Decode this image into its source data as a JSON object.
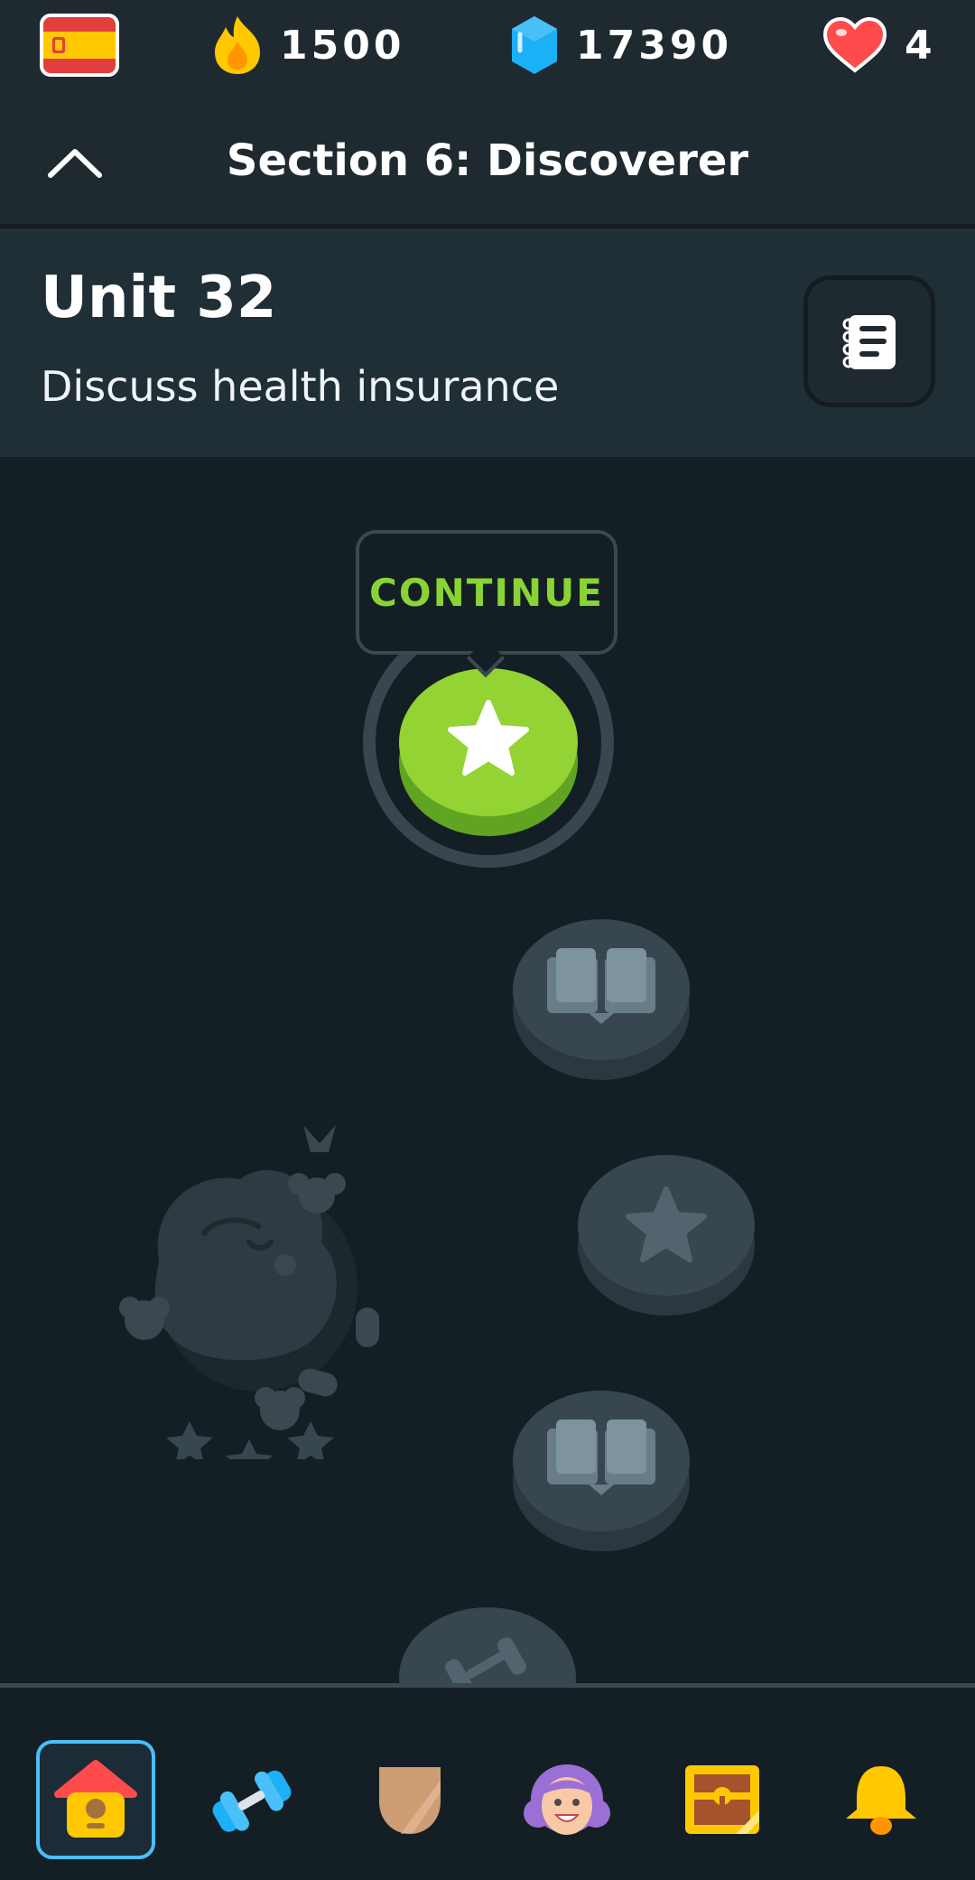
{
  "stats": {
    "language_flag": "spain-flag",
    "streak": "1500",
    "gems": "17390",
    "hearts": "4"
  },
  "section": {
    "title": "Section 6: Discoverer"
  },
  "unit": {
    "title": "Unit 32",
    "subtitle": "Discuss health insurance"
  },
  "path": {
    "tooltip_label": "CONTINUE",
    "nodes": [
      {
        "type": "star-lesson",
        "state": "active",
        "progress": 0.08
      },
      {
        "type": "book-story",
        "state": "locked"
      },
      {
        "type": "star-lesson",
        "state": "locked"
      },
      {
        "type": "book-story",
        "state": "locked"
      },
      {
        "type": "practice",
        "state": "locked"
      }
    ]
  },
  "bottom_nav": [
    {
      "id": "learn",
      "icon": "home-icon",
      "active": true
    },
    {
      "id": "practice",
      "icon": "dumbbell-icon",
      "active": false
    },
    {
      "id": "leagues",
      "icon": "shield-icon",
      "active": false
    },
    {
      "id": "profile",
      "icon": "avatar-icon",
      "active": false
    },
    {
      "id": "shop",
      "icon": "treasure-chest-icon",
      "active": false
    },
    {
      "id": "notifications",
      "icon": "bell-icon",
      "active": false
    }
  ],
  "colors": {
    "background": "#131f24",
    "header": "#1f2a30",
    "accent_green": "#89d335",
    "locked_node": "#37464f",
    "active_tab_border": "#49c0f8"
  }
}
